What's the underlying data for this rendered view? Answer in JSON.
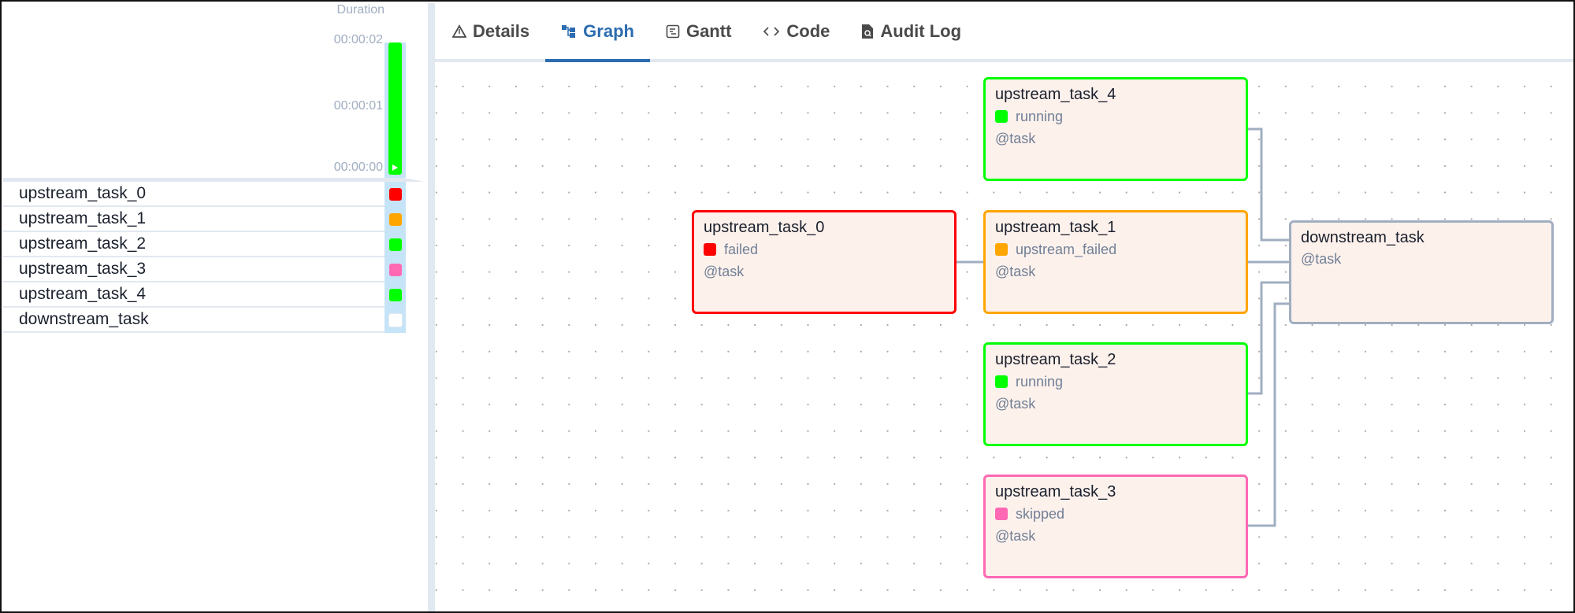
{
  "grid": {
    "duration_label": "Duration",
    "ticks": [
      "00:00:02",
      "00:00:01",
      "00:00:00"
    ],
    "run": {
      "state": "running",
      "color": "#00ff00",
      "duration_fraction_of_max": 1.0
    },
    "tasks": [
      {
        "name": "upstream_task_0",
        "state": "failed",
        "color": "#ff0000"
      },
      {
        "name": "upstream_task_1",
        "state": "upstream_failed",
        "color": "#ffa500"
      },
      {
        "name": "upstream_task_2",
        "state": "running",
        "color": "#00ff00"
      },
      {
        "name": "upstream_task_3",
        "state": "skipped",
        "color": "#ff69b4"
      },
      {
        "name": "upstream_task_4",
        "state": "running",
        "color": "#00ff00"
      },
      {
        "name": "downstream_task",
        "state": "none",
        "color": "#ffffff"
      }
    ]
  },
  "tabs": [
    {
      "label": "Details",
      "icon": "warning-triangle-icon",
      "active": false
    },
    {
      "label": "Graph",
      "icon": "graph-icon",
      "active": true
    },
    {
      "label": "Gantt",
      "icon": "gantt-icon",
      "active": false
    },
    {
      "label": "Code",
      "icon": "code-icon",
      "active": false
    },
    {
      "label": "Audit Log",
      "icon": "audit-log-icon",
      "active": false
    }
  ],
  "graph": {
    "nodes": [
      {
        "id": "upstream_task_4",
        "title": "upstream_task_4",
        "state": "running",
        "color": "#00ff00",
        "operator": "@task"
      },
      {
        "id": "upstream_task_0",
        "title": "upstream_task_0",
        "state": "failed",
        "color": "#ff0000",
        "operator": "@task"
      },
      {
        "id": "upstream_task_1",
        "title": "upstream_task_1",
        "state": "upstream_failed",
        "color": "#ffa500",
        "operator": "@task"
      },
      {
        "id": "upstream_task_2",
        "title": "upstream_task_2",
        "state": "running",
        "color": "#00ff00",
        "operator": "@task"
      },
      {
        "id": "upstream_task_3",
        "title": "upstream_task_3",
        "state": "skipped",
        "color": "#ff69b4",
        "operator": "@task"
      },
      {
        "id": "downstream_task",
        "title": "downstream_task",
        "state": null,
        "color": "#a0aec0",
        "operator": "@task"
      }
    ],
    "edges": [
      [
        "upstream_task_0",
        "upstream_task_1"
      ],
      [
        "upstream_task_4",
        "downstream_task"
      ],
      [
        "upstream_task_1",
        "downstream_task"
      ],
      [
        "upstream_task_2",
        "downstream_task"
      ],
      [
        "upstream_task_3",
        "downstream_task"
      ]
    ],
    "edge_color": "#a0aec0"
  }
}
